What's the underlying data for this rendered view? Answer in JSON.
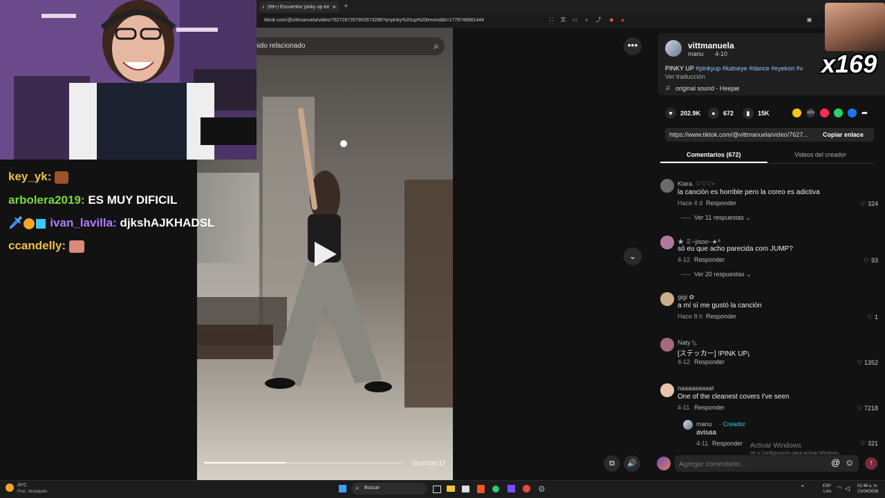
{
  "browser": {
    "tab_title": "(99+) Encuentra 'pinky up tre...",
    "tab_close": "×",
    "new_tab": "+",
    "url": "tiktok.com/@vittmanuela/video/7627287267903573268?q=pinky%20up%20trenmd&t=1776746881444"
  },
  "chat": {
    "lines": [
      {
        "user": "key_yk:",
        "text": "",
        "user_color": "#f0c040"
      },
      {
        "user": "arbolera2019:",
        "text": "ES MUY DIFICIL",
        "user_color": "#7cd83c"
      },
      {
        "user": "ivan_lavilla:",
        "text": "djkshAJKHADSL",
        "user_color": "#b07cff"
      },
      {
        "user": "ccandelly:",
        "text": "",
        "user_color": "#f0c040"
      }
    ]
  },
  "video": {
    "related_label": "nido relacionado",
    "time": "00:07/00:17",
    "progress": 0.41
  },
  "overlay": {
    "count": "x169"
  },
  "creator": {
    "username": "vittmanuela",
    "nickname": "manu",
    "date": "4-10",
    "caption_prefix": "PINKY UP",
    "hashtags": "#pinkyup #katseye #dance #eyekon #v",
    "translate": "Ver traducción",
    "sound": "original sound - Heejae"
  },
  "stats": {
    "likes": "202.9K",
    "comments": "672",
    "saves": "15K"
  },
  "link": {
    "url": "https://www.tiktok.com/@vittmanuela/video/7627...",
    "copy_label": "Copiar enlace"
  },
  "tabs": {
    "comments": "Comentarios (672)",
    "creator_videos": "Videos del creador"
  },
  "comments": [
    {
      "user": "Kiara. ♡♡♡ᵕ",
      "text": "la canción es horrible pero la coreo es adictiva",
      "time": "Hace 4 d",
      "reply": "Responder",
      "likes": "324",
      "replies": "Ver 11 respuestas"
    },
    {
      "user": "★ ミ~jisoo~★ᐞ",
      "text": "só eu que acho parecida com JUMP?",
      "time": "4-12",
      "reply": "Responder",
      "likes": "93",
      "replies": "Ver 20 respuestas"
    },
    {
      "user": "gigi ✿",
      "text": "a mí sí me gustó la canción",
      "time": "Hace 8 h",
      "reply": "Responder",
      "likes": "1",
      "replies": ""
    },
    {
      "user": "Naty !¡.",
      "text": "[ステッカー] !PINK UP¡",
      "time": "4-12",
      "reply": "Responder",
      "likes": "1352",
      "replies": ""
    },
    {
      "user": "naaaaaaaaat",
      "text": "One of the cleanest covers I've seen",
      "time": "4-11",
      "reply": "Responder",
      "likes": "7218",
      "replies": ""
    }
  ],
  "creator_reply": {
    "user": "manu",
    "badge": "· Creador",
    "text": "avisaa",
    "time": "4-11",
    "reply": "Responder",
    "likes": "321"
  },
  "comment_input": {
    "placeholder": "Agregar comentario..."
  },
  "watermark": {
    "line1": "Activar Windows",
    "line2": "Ve a Configuración para activar Windows."
  },
  "taskbar": {
    "weather_temp": "20°C",
    "weather_desc": "Prac. despejado",
    "search": "Buscar",
    "lang1": "ESP",
    "lang2": "LAA",
    "time": "01:48 a. m.",
    "date": "21/04/2026"
  },
  "colors": {
    "accent": "#fe2c55",
    "link": "#4aa3ff",
    "creator_badge": "#20d5ec"
  }
}
